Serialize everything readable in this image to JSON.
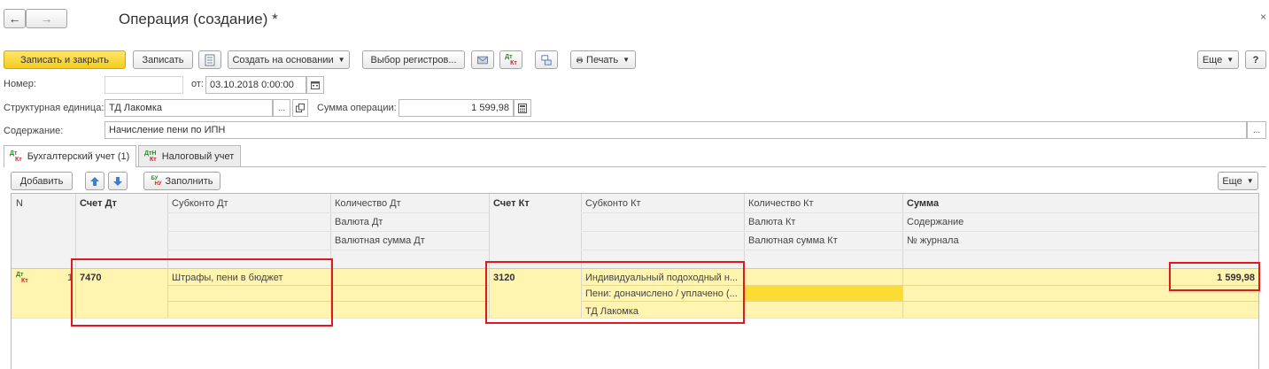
{
  "window": {
    "title": "Операция (создание) *"
  },
  "nav": {
    "back": "←",
    "forward": "→",
    "close": "×"
  },
  "toolbar": {
    "save_close": "Записать и закрыть",
    "save": "Записать",
    "create_based": "Создать на основании",
    "select_registers": "Выбор регистров...",
    "print": "Печать",
    "more": "Еще",
    "help": "?"
  },
  "form": {
    "number_label": "Номер:",
    "number_value": "",
    "date_label": "от:",
    "date_value": "03.10.2018  0:00:00",
    "unit_label": "Структурная единица:",
    "unit_value": "ТД Лакомка",
    "sum_label": "Сумма операции:",
    "sum_value": "1 599,98",
    "content_label": "Содержание:",
    "content_value": "Начисление пени по ИПН",
    "ellipsis": "..."
  },
  "tabs": [
    {
      "label": "Бухгалтерский учет (1)",
      "active": true
    },
    {
      "label": "Налоговый учет",
      "active": false
    }
  ],
  "table_toolbar": {
    "add": "Добавить",
    "fill": "Заполнить",
    "more": "Еще"
  },
  "table": {
    "headers": {
      "n": "N",
      "acc_dt": "Счет Дт",
      "sub_dt": "Субконто Дт",
      "qty_dt": "Количество Дт",
      "cur_dt": "Валюта Дт",
      "cur_sum_dt": "Валютная сумма Дт",
      "acc_kt": "Счет Кт",
      "sub_kt": "Субконто Кт",
      "qty_kt": "Количество Кт",
      "cur_kt": "Валюта Кт",
      "cur_sum_kt": "Валютная сумма Кт",
      "sum": "Сумма",
      "content": "Содержание",
      "journal": "№ журнала"
    },
    "row": {
      "n": "1",
      "acc_dt": "7470",
      "sub_dt_1": "Штрафы, пени в бюджет",
      "acc_kt": "3120",
      "sub_kt_1": "Индивидуальный подоходный н...",
      "sub_kt_2": "Пени: доначислено / уплачено (...",
      "sub_kt_3": "ТД Лакомка",
      "sum": "1 599,98"
    }
  },
  "icons": {
    "dt": "Дт",
    "kt": "Кт",
    "ntax": "Н",
    "bu": "БУ",
    "nu": "НУ"
  },
  "colors": {
    "accent": "#f4cd1c",
    "row_highlight": "#fff4b0",
    "active_cell": "#fbdc35",
    "annotation": "#e4171c"
  }
}
